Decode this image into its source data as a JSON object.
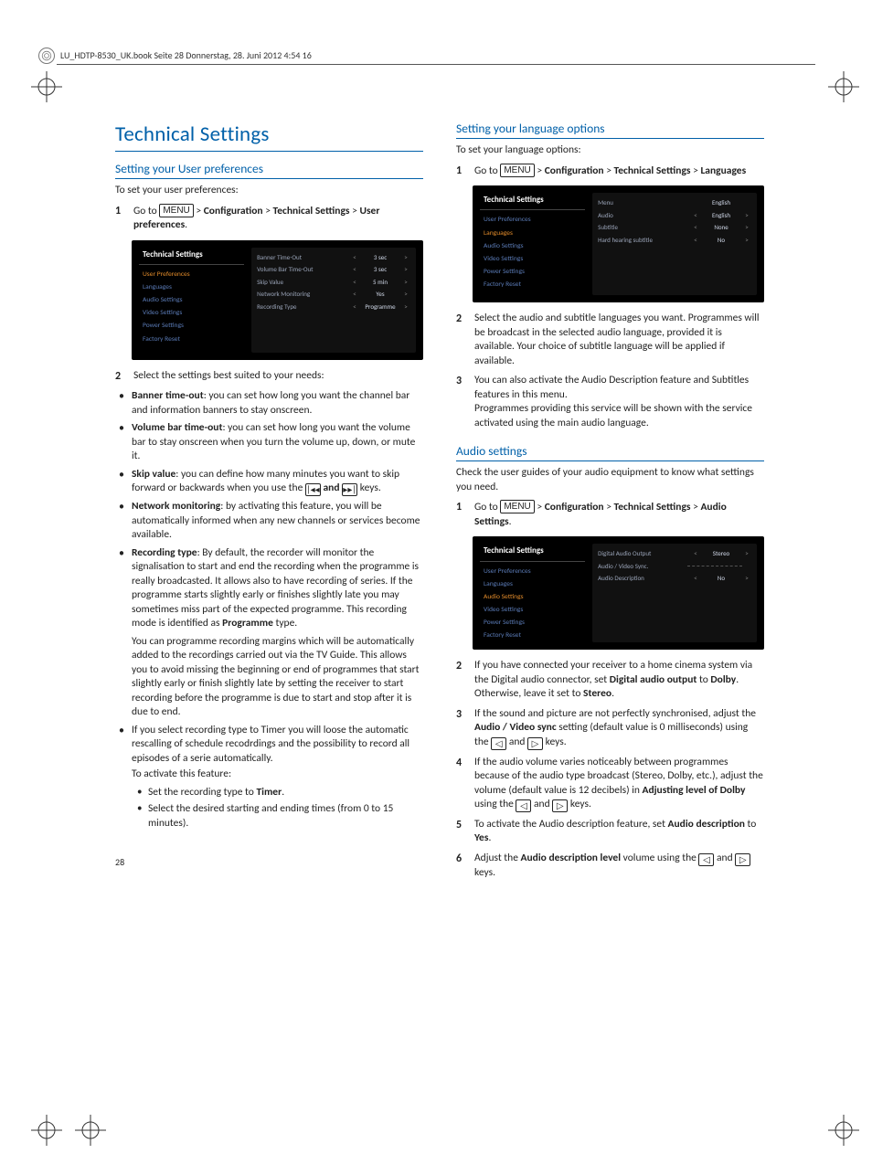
{
  "header_note": "LU_HDTP-8530_UK.book  Seite 28  Donnerstag, 28. Juni 2012  4:54 16",
  "page_number": "28",
  "left": {
    "h1": "Technical Settings",
    "h2a": "Setting your User preferences",
    "intro": "To set your user preferences:",
    "step1_pre": "Go to ",
    "step1_menu": "MENU",
    "step1_mid": " > ",
    "step1_conf": "Configuration",
    "step1_ts": "Technical Settings",
    "step1_up": "User preferences",
    "ss1": {
      "title": "Technical Settings",
      "items": [
        "User Preferences",
        "Languages",
        "Audio Settings",
        "Video Settings",
        "Power Settings",
        "Factory Reset"
      ],
      "sel": "User Preferences",
      "rows": [
        {
          "lab": "Banner Time-Out",
          "val": "3 sec"
        },
        {
          "lab": "Volume Bar Time-Out",
          "val": "3 sec"
        },
        {
          "lab": "Skip Value",
          "val": "5 min"
        },
        {
          "lab": "Network Monitoring",
          "val": "Yes"
        },
        {
          "lab": "Recording Type",
          "val": "Programme"
        }
      ]
    },
    "step2": "Select the settings best suited to your needs:",
    "b1_label": "Banner time-out",
    "b1_text": ": you can set how long you want the channel bar and information banners to stay onscreen.",
    "b2_label": "Volume bar time-out",
    "b2_text": ": you can set how long you want the volume bar to stay onscreen when you turn the volume up, down, or mute it.",
    "b3_label": "Skip value",
    "b3_text_a": ": you can define how many minutes you want to skip forward or backwards when you use the ",
    "b3_and": " and ",
    "b3_text_b": " keys.",
    "b4_label": "Network monitoring",
    "b4_text": ": by activating this feature, you will be automatically informed when any new channels or services become available.",
    "b5_label": "Recording type",
    "b5_text_a": ": By default, the recorder will monitor the signalisation to start and end the recording when the programme is really broadcasted. It allows also to have recording of series. If the programme starts slightly early or finishes slightly late you may sometimes miss part of the expected programme. This recording mode is identified as ",
    "b5_prog": "Programme",
    "b5_text_b": " type.",
    "b5_para2": "You can programme recording margins which will be automatically added to the recordings carried out via the TV Guide. This allows you to avoid missing the beginning or end of programmes that start slightly early or finish slightly late by setting the receiver to start recording before the programme is due to start and stop after it is due to end.",
    "b6_text": "If you select recording type to Timer you will loose the automatic rescalling of schedule recodrdings and the possibility to record all episodes of a serie automatically.",
    "b6_act": "To activate this feature:",
    "b6_s1_a": "Set the recording type to ",
    "b6_s1_b": "Timer",
    "b6_s1_c": ".",
    "b6_s2": "Select the desired starting and ending times (from 0 to 15 minutes)."
  },
  "right": {
    "h2a": "Setting your language options",
    "intro_a": "To set your language options:",
    "step1_pre": "Go to ",
    "step1_menu": "MENU",
    "step1_conf": "Configuration",
    "step1_ts": "Technical Settings",
    "step1_lang": "Languages",
    "ss2": {
      "title": "Technical Settings",
      "items": [
        "User Preferences",
        "Languages",
        "Audio Settings",
        "Video Settings",
        "Power Settings",
        "Factory Reset"
      ],
      "sel": "Languages",
      "rows": [
        {
          "lab": "Menu",
          "val": "English",
          "noL": true
        },
        {
          "lab": "Audio",
          "val": "English"
        },
        {
          "lab": "Subtitle",
          "val": "None"
        },
        {
          "lab": "Hard hearing subtitle",
          "val": "No"
        }
      ]
    },
    "step2": "Select the audio and subtitle languages you want. Programmes will be broadcast in the selected audio language, provided it is available. Your choice of subtitle language will be applied if available.",
    "step3a": "You can also activate the Audio Description feature and Subtitles features in this menu.",
    "step3b": "Programmes providing this service will be shown with the service activated using the main audio language.",
    "h2b": "Audio settings",
    "intro_b": "Check the user guides of your audio equipment to know what settings you need.",
    "stepB1_pre": "Go to ",
    "stepB1_menu": "MENU",
    "stepB1_conf": "Configuration",
    "stepB1_ts": "Technical Settings",
    "stepB1_as": "Audio Settings",
    "ss3": {
      "title": "Technical Settings",
      "items": [
        "User Preferences",
        "Languages",
        "Audio Settings",
        "Video Settings",
        "Power Settings",
        "Factory Reset"
      ],
      "sel": "Audio Settings",
      "rows": [
        {
          "lab": "Digital Audio Output",
          "val": "Stereo"
        },
        {
          "lab": "Audio / Video Sync.",
          "val": ""
        },
        {
          "lab": "Audio Description",
          "val": "No"
        }
      ]
    },
    "stepB2_a": "If you have connected your receiver to a home cinema system via the Digital audio connector, set ",
    "stepB2_b": "Digital audio output",
    "stepB2_c": " to ",
    "stepB2_d": "Dolby",
    "stepB2_e": ". Otherwise, leave it set to ",
    "stepB2_f": "Stereo",
    "stepB2_g": ".",
    "stepB3_a": "If the sound and picture are not perfectly synchronised, adjust the ",
    "stepB3_b": "Audio / Video sync",
    "stepB3_c": " setting (default value is 0 milliseconds) using the ",
    "stepB3_d": " and ",
    "stepB3_e": " keys.",
    "stepB4_a": "If the audio volume varies noticeably between programmes because of the audio type broadcast (Stereo, Dolby, etc.), adjust the volume (default value is 12 decibels) in ",
    "stepB4_b": "Adjusting level of Dolby",
    "stepB4_c": " using the ",
    "stepB4_d": " and ",
    "stepB4_e": " keys.",
    "stepB5_a": "To activate the Audio description feature, set ",
    "stepB5_b": "Audio description",
    "stepB5_c": " to ",
    "stepB5_d": "Yes",
    "stepB5_e": ".",
    "stepB6_a": "Adjust the ",
    "stepB6_b": "Audio description level",
    "stepB6_c": " volume using the ",
    "stepB6_d": " and ",
    "stepB6_e": " keys."
  }
}
